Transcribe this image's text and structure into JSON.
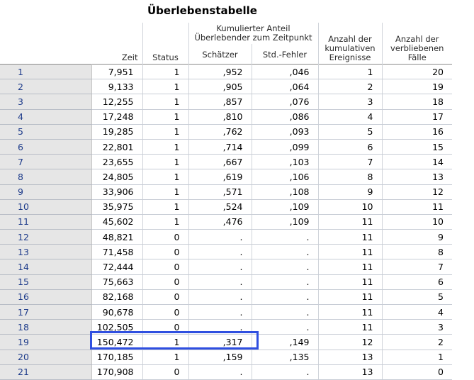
{
  "title": "Überlebenstabelle",
  "headers": {
    "zeit": "Zeit",
    "status": "Status",
    "group": "Kumulierter Anteil Überlebender zum Zeitpunkt",
    "schaetzer": "Schätzer",
    "std_fehler": "Std.-Fehler",
    "ereignisse": "Anzahl der kumulativen Ereignisse",
    "verbleibend": "Anzahl der verbliebenen Fälle"
  },
  "rows": [
    {
      "n": "1",
      "zeit": "7,951",
      "status": "1",
      "est": ",952",
      "se": ",046",
      "ereig": "1",
      "verbl": "20"
    },
    {
      "n": "2",
      "zeit": "9,133",
      "status": "1",
      "est": ",905",
      "se": ",064",
      "ereig": "2",
      "verbl": "19"
    },
    {
      "n": "3",
      "zeit": "12,255",
      "status": "1",
      "est": ",857",
      "se": ",076",
      "ereig": "3",
      "verbl": "18"
    },
    {
      "n": "4",
      "zeit": "17,248",
      "status": "1",
      "est": ",810",
      "se": ",086",
      "ereig": "4",
      "verbl": "17"
    },
    {
      "n": "5",
      "zeit": "19,285",
      "status": "1",
      "est": ",762",
      "se": ",093",
      "ereig": "5",
      "verbl": "16"
    },
    {
      "n": "6",
      "zeit": "22,801",
      "status": "1",
      "est": ",714",
      "se": ",099",
      "ereig": "6",
      "verbl": "15"
    },
    {
      "n": "7",
      "zeit": "23,655",
      "status": "1",
      "est": ",667",
      "se": ",103",
      "ereig": "7",
      "verbl": "14"
    },
    {
      "n": "8",
      "zeit": "24,805",
      "status": "1",
      "est": ",619",
      "se": ",106",
      "ereig": "8",
      "verbl": "13"
    },
    {
      "n": "9",
      "zeit": "33,906",
      "status": "1",
      "est": ",571",
      "se": ",108",
      "ereig": "9",
      "verbl": "12"
    },
    {
      "n": "10",
      "zeit": "35,975",
      "status": "1",
      "est": ",524",
      "se": ",109",
      "ereig": "10",
      "verbl": "11"
    },
    {
      "n": "11",
      "zeit": "45,602",
      "status": "1",
      "est": ",476",
      "se": ",109",
      "ereig": "11",
      "verbl": "10"
    },
    {
      "n": "12",
      "zeit": "48,821",
      "status": "0",
      "est": ".",
      "se": ".",
      "ereig": "11",
      "verbl": "9"
    },
    {
      "n": "13",
      "zeit": "71,458",
      "status": "0",
      "est": ".",
      "se": ".",
      "ereig": "11",
      "verbl": "8"
    },
    {
      "n": "14",
      "zeit": "72,444",
      "status": "0",
      "est": ".",
      "se": ".",
      "ereig": "11",
      "verbl": "7"
    },
    {
      "n": "15",
      "zeit": "75,663",
      "status": "0",
      "est": ".",
      "se": ".",
      "ereig": "11",
      "verbl": "6"
    },
    {
      "n": "16",
      "zeit": "82,168",
      "status": "0",
      "est": ".",
      "se": ".",
      "ereig": "11",
      "verbl": "5"
    },
    {
      "n": "17",
      "zeit": "90,678",
      "status": "0",
      "est": ".",
      "se": ".",
      "ereig": "11",
      "verbl": "4"
    },
    {
      "n": "18",
      "zeit": "102,505",
      "status": "0",
      "est": ".",
      "se": ".",
      "ereig": "11",
      "verbl": "3"
    },
    {
      "n": "19",
      "zeit": "150,472",
      "status": "1",
      "est": ",317",
      "se": ",149",
      "ereig": "12",
      "verbl": "2"
    },
    {
      "n": "20",
      "zeit": "170,185",
      "status": "1",
      "est": ",159",
      "se": ",135",
      "ereig": "13",
      "verbl": "1"
    },
    {
      "n": "21",
      "zeit": "170,908",
      "status": "0",
      "est": ".",
      "se": ".",
      "ereig": "13",
      "verbl": "0"
    }
  ],
  "colors": {
    "highlight_border": "#2f4fe0",
    "row_header_bg": "#e6e6e6",
    "row_header_text": "#1d3b8a"
  }
}
